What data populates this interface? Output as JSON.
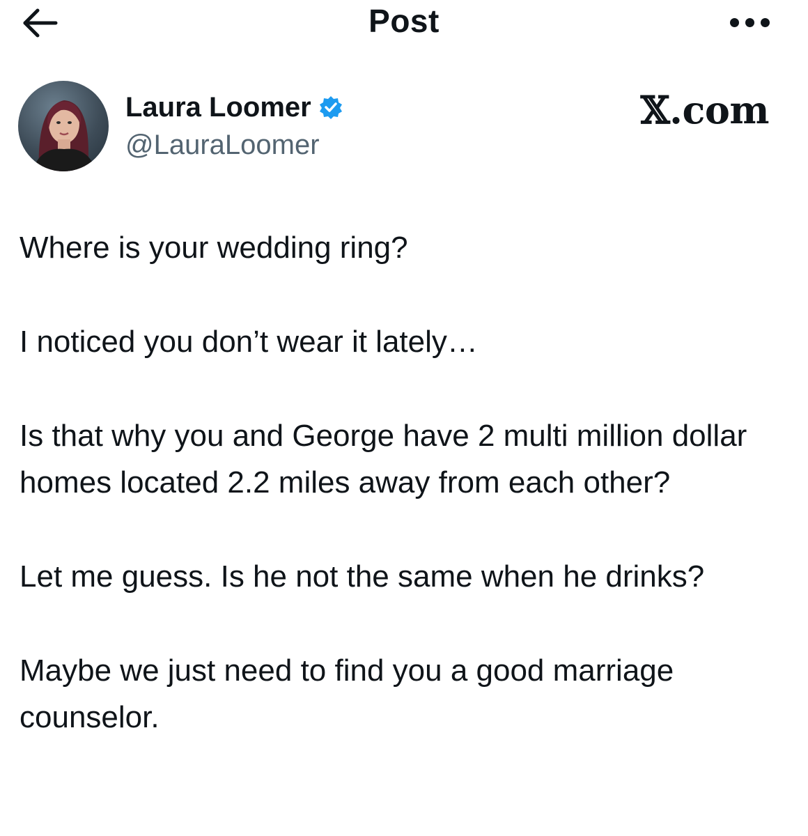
{
  "header": {
    "title": "Post",
    "back_icon": "arrow-left-icon",
    "more_icon": "more-horizontal-icon"
  },
  "author": {
    "name": "Laura Loomer",
    "handle": "@LauraLoomer",
    "verified": true,
    "verified_color": "#1d9bf0"
  },
  "brand": {
    "text": "𝕏.com"
  },
  "post": {
    "paragraphs": [
      "Where is your wedding ring?",
      "I noticed you don’t wear it lately…",
      "Is that why you and George have 2 multi million dollar homes located 2.2 miles away from each other?",
      "Let me guess. Is he not the same when he drinks?",
      "Maybe we just need to find you a good marriage counselor."
    ]
  }
}
